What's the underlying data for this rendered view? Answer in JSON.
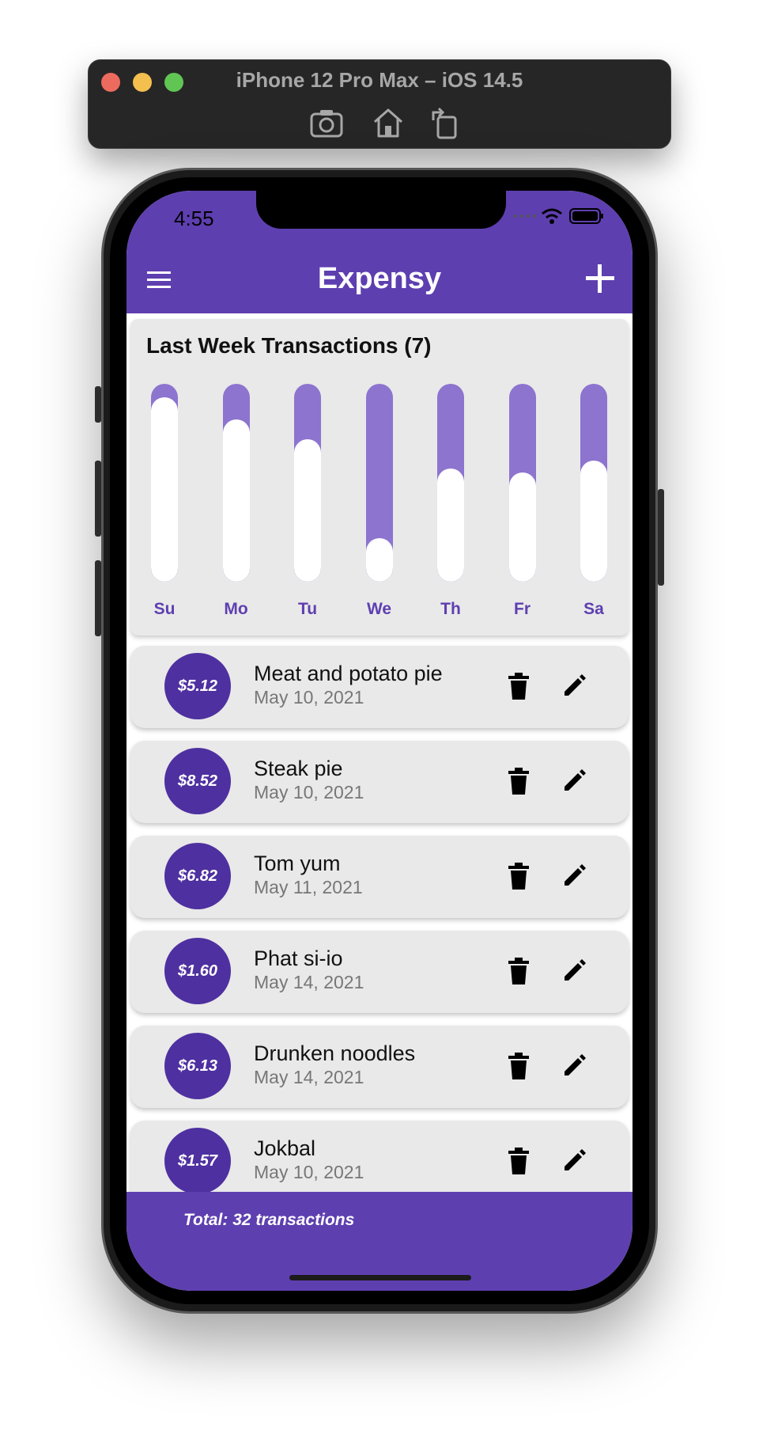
{
  "simulator": {
    "title": "iPhone 12 Pro Max – iOS 14.5",
    "tools": [
      "screenshot-icon",
      "home-icon",
      "rotate-icon"
    ]
  },
  "status_bar": {
    "time": "4:55"
  },
  "app_bar": {
    "title": "Expensy",
    "menu_icon": "menu-icon",
    "add_icon": "add-icon"
  },
  "chart": {
    "title": "Last Week Transactions (7)"
  },
  "chart_data": {
    "type": "bar",
    "title": "Last Week Transactions (7)",
    "categories": [
      "Su",
      "Mo",
      "Tu",
      "We",
      "Th",
      "Fr",
      "Sa"
    ],
    "values": [
      0.93,
      0.82,
      0.72,
      0.22,
      0.57,
      0.55,
      0.61
    ],
    "ylim": [
      0,
      1
    ],
    "bar_color": "#ffffff",
    "track_color": "#8c74cf",
    "label_color": "#5e3fb0",
    "grid": false
  },
  "transactions": [
    {
      "amount": "$5.12",
      "title": "Meat and potato pie",
      "date": "May 10, 2021"
    },
    {
      "amount": "$8.52",
      "title": "Steak pie",
      "date": "May 10, 2021"
    },
    {
      "amount": "$6.82",
      "title": "Tom yum",
      "date": "May 11, 2021"
    },
    {
      "amount": "$1.60",
      "title": "Phat si-io",
      "date": "May 14, 2021"
    },
    {
      "amount": "$6.13",
      "title": "Drunken noodles",
      "date": "May 14, 2021"
    },
    {
      "amount": "$1.57",
      "title": "Jokbal",
      "date": "May 10, 2021"
    }
  ],
  "footer": {
    "text": "Total: 32 transactions"
  },
  "colors": {
    "primary": "#5e3fb0",
    "amount_circle": "#4e30a0",
    "card": "#e9e9e9"
  }
}
